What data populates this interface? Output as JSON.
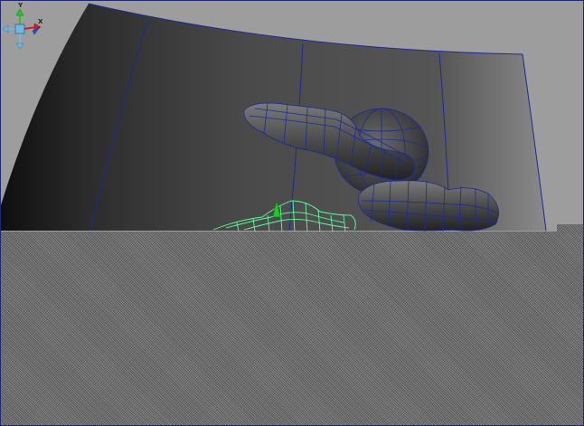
{
  "viewport": {
    "background": "#9d9d9d",
    "wireframe_color": "#1a2a9a",
    "selected_wireframe_color": "#5dff9a",
    "manipulator_color": "#18d018"
  },
  "view_cube": {
    "labels": {
      "y": "Y",
      "x": "X"
    },
    "colors": {
      "y_axis": "#29c429",
      "x_axis": "#d02020",
      "z_axis": "#2050e0",
      "core": "#6fb9e0"
    }
  }
}
